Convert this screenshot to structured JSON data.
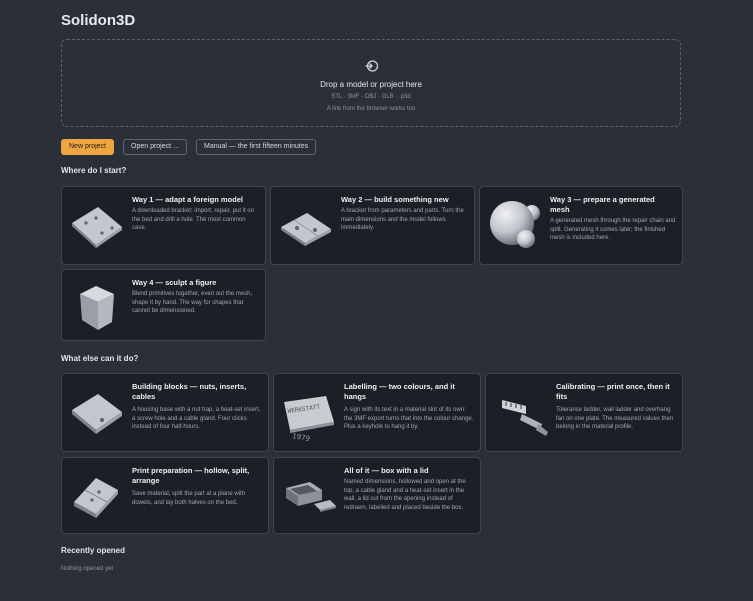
{
  "app": {
    "title": "Solidon3D"
  },
  "dropzone": {
    "icon": "import-icon",
    "title": "Drop a model or project here",
    "formats": "STL · 3MF · OBJ · GLB · .p3d",
    "hint": "A link from the browser works too"
  },
  "actions": {
    "new_project": "New project",
    "open_project": "Open project ...",
    "manual": "Manual — the first fifteen minutes"
  },
  "sections": {
    "start": "Where do I start?",
    "else": "What else can it do?",
    "recent": "Recently opened"
  },
  "ways": [
    {
      "title": "Way 1 — adapt a foreign model",
      "desc": "A downloaded bracket: import, repair, put it on the bed and drill a hole. The most common case."
    },
    {
      "title": "Way 2 — build something new",
      "desc": "A bracket from parameters and parts. Turn the main dimensions and the model follows immediately."
    },
    {
      "title": "Way 3 — prepare a generated mesh",
      "desc": "A generated mesh through the repair chain and split. Generating it comes later; the finished mesh is included here."
    },
    {
      "title": "Way 4 — sculpt a figure",
      "desc": "Blend primitives together, even out the mesh, shape it by hand. The way for shapes that cannot be dimensioned."
    }
  ],
  "features": [
    {
      "title": "Building blocks — nuts, inserts, cables",
      "desc": "A housing base with a nut trap, a heat-set insert, a screw hole and a cable gland. Four clicks instead of four half-hours."
    },
    {
      "title": "Labelling — two colours, and it hangs",
      "desc": "A sign with its text in a material slot of its own: the 3MF export turns that into the colour change. Plus a keyhole to hang it by.",
      "thumb_text": "WERKSTATT",
      "thumb_year": "1979"
    },
    {
      "title": "Calibrating — print once, then it fits",
      "desc": "Tolerance ladder, wall ladder and overhang fan on one plate. The measured values then belong in the material profile."
    },
    {
      "title": "Print preparation — hollow, split, arrange",
      "desc": "Save material, split the part at a plane with dowels, and lay both halves on the bed."
    },
    {
      "title": "All of it — box with a lid",
      "desc": "Named dimensions, hollowed and open at the top, a cable gland and a heat-set insert in the wall, a lid cut from the opening instead of redrawn, labelled and placed beside the box."
    }
  ],
  "recent": {
    "empty": "Nothing opened yet"
  }
}
